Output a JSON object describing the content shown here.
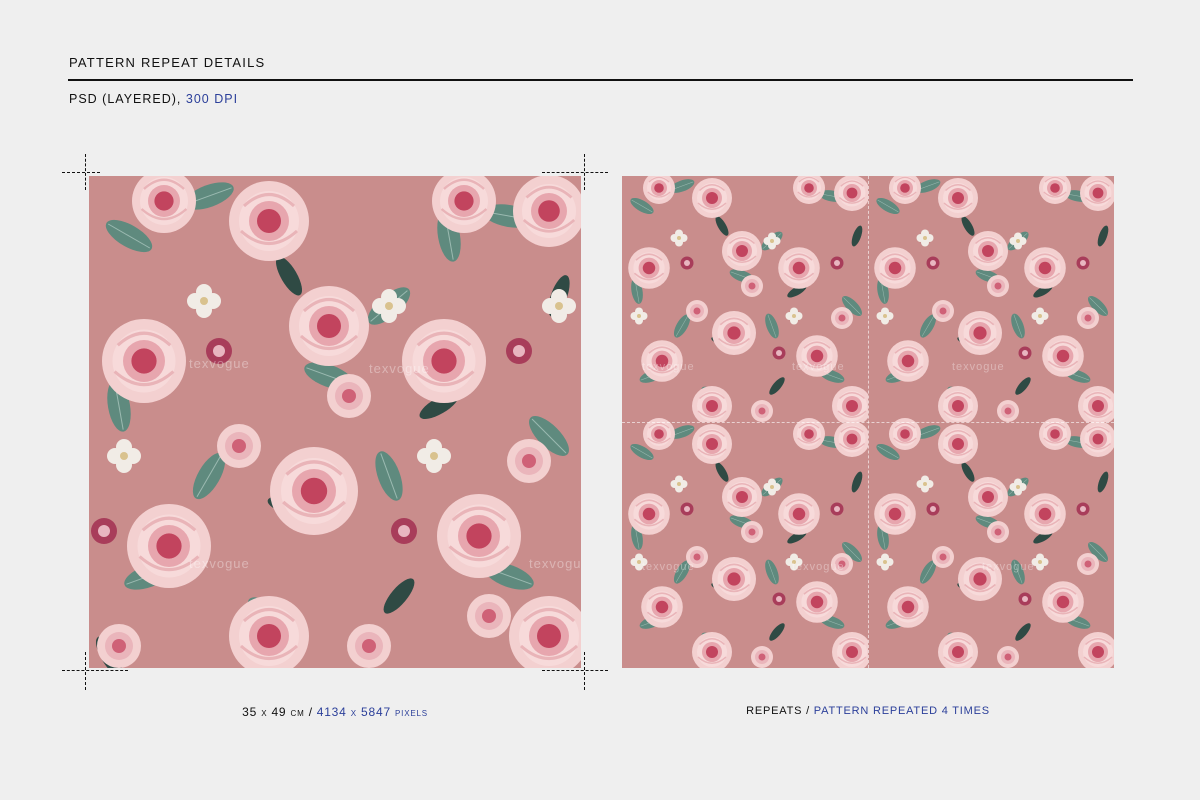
{
  "header": {
    "title": "PATTERN REPEAT DETAILS",
    "format": "PSD (LAYERED),",
    "resolution": "300 DPI"
  },
  "captions": {
    "left_size": "35 x 49 cm /",
    "left_pixels": "4134 x 5847 pixels",
    "right_label": "REPEATS /",
    "right_detail": "PATTERN REPEATED 4 TIMES"
  },
  "watermark": "texvogue",
  "colors": {
    "background": "#efefef",
    "accent": "#2b3f9a",
    "pattern_ground": "#c98d8c",
    "rose_light": "#f4cfcf",
    "rose_deep": "#c2445e",
    "leaf": "#5f8a7e",
    "leaf_dark": "#2f4a44"
  }
}
